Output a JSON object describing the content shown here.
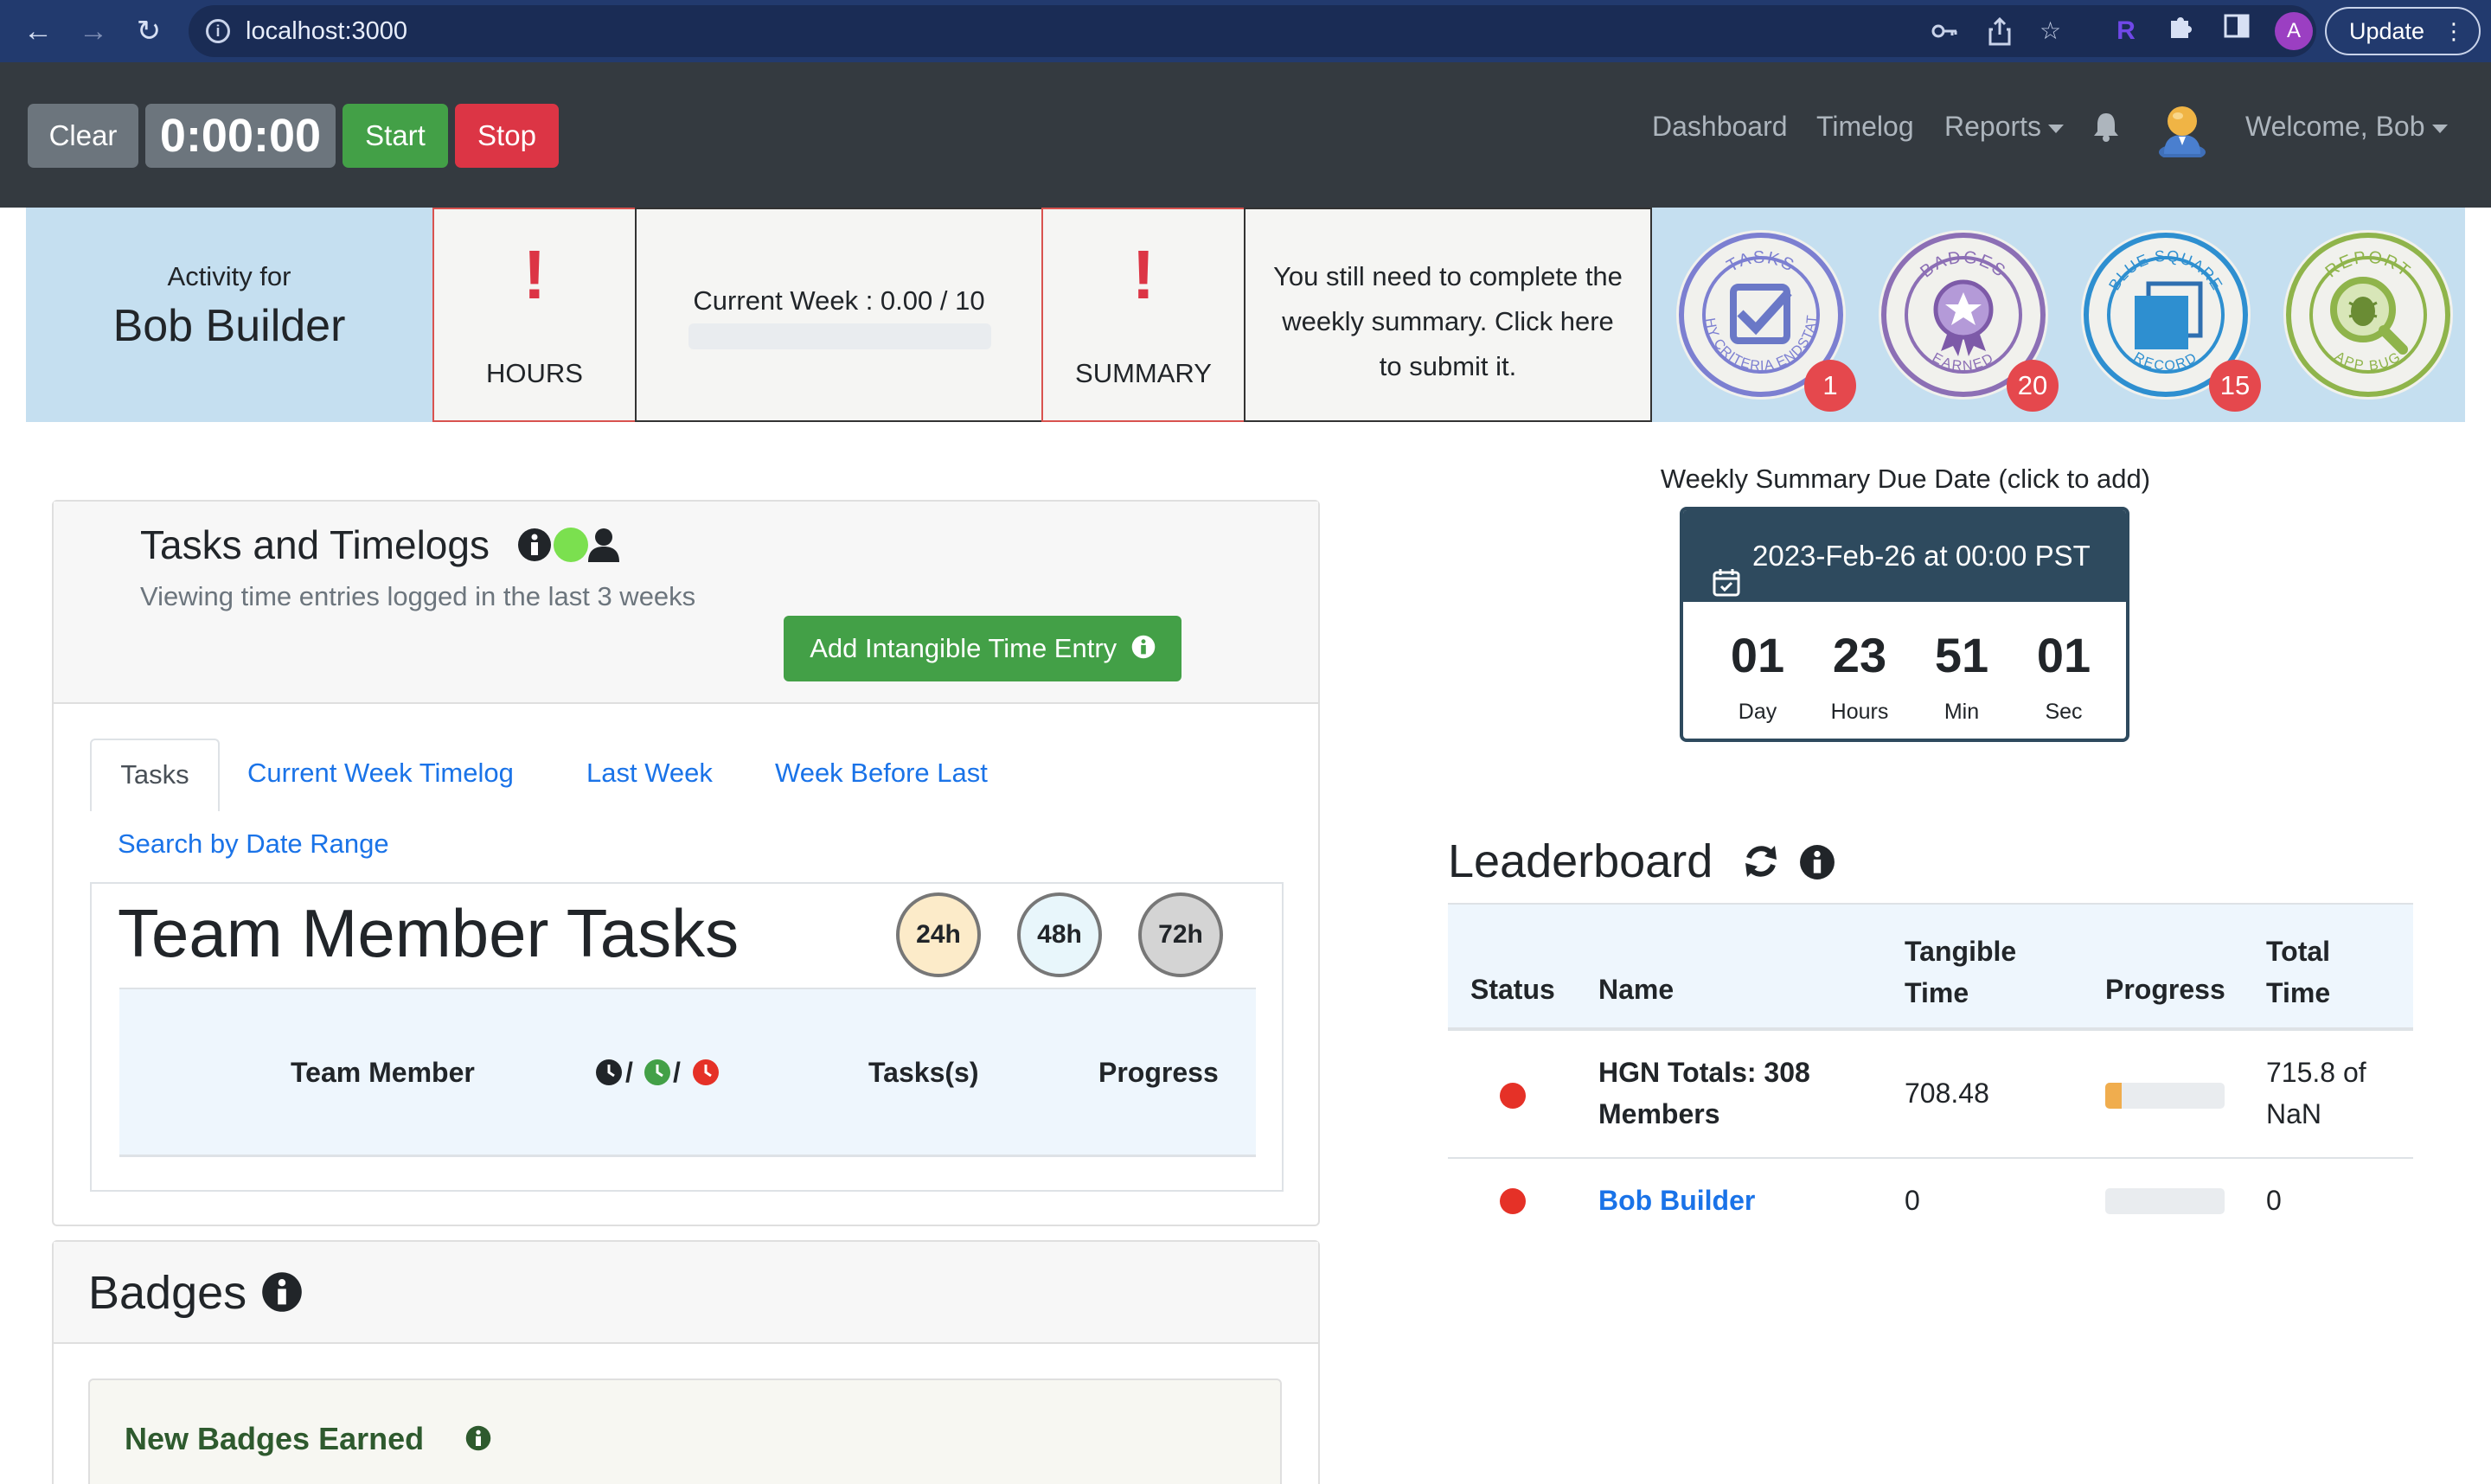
{
  "browser": {
    "url": "localhost:3000",
    "profile_initial": "A",
    "update_label": "Update"
  },
  "timer": {
    "clear_label": "Clear",
    "display": "0:00:00",
    "start_label": "Start",
    "stop_label": "Stop"
  },
  "nav": {
    "dashboard": "Dashboard",
    "timelog": "Timelog",
    "reports": "Reports",
    "welcome": "Welcome, Bob"
  },
  "activity": {
    "label": "Activity for",
    "name": "Bob Builder",
    "hours_label": "HOURS",
    "current_week": "Current Week : 0.00 / 10",
    "week_progress": 0,
    "summary_label": "SUMMARY",
    "summary_message": [
      "You still need to complete the",
      "weekly summary. Click here",
      "to submit it."
    ],
    "badges": [
      {
        "top": "TASKS",
        "bottom": "WHY CRITERIA ENDSTATE",
        "count": "1",
        "color": "#7c7fd1"
      },
      {
        "top": "BADGES",
        "bottom": "EARNED",
        "count": "20",
        "color": "#8c6fb5"
      },
      {
        "top": "BLUE SQUARE",
        "bottom": "RECORD",
        "count": "15",
        "color": "#2e8fd0"
      },
      {
        "top": "REPORT",
        "bottom": "APP BUG",
        "count": "",
        "color": "#8fb44b"
      }
    ]
  },
  "tasks_card": {
    "title": "Tasks and Timelogs",
    "subtitle": "Viewing time entries logged in the last 3 weeks",
    "add_button": "Add Intangible Time Entry",
    "tabs": [
      "Tasks",
      "Current Week Timelog",
      "Last Week",
      "Week Before Last",
      "Search by Date Range"
    ],
    "section_title": "Team Member Tasks",
    "time_filters": [
      "24h",
      "48h",
      "72h"
    ],
    "columns": [
      "Team Member",
      "Tasks(s)",
      "Progress"
    ],
    "column_sep": "/"
  },
  "badges_card": {
    "title": "Badges",
    "new_badges": "New Badges Earned"
  },
  "due_date": {
    "label": "Weekly Summary Due Date (click to add)",
    "date": "2023-Feb-26 at 00:00 PST",
    "countdown": [
      {
        "value": "01",
        "unit": "Day"
      },
      {
        "value": "23",
        "unit": "Hours"
      },
      {
        "value": "51",
        "unit": "Min"
      },
      {
        "value": "01",
        "unit": "Sec"
      }
    ]
  },
  "leaderboard": {
    "title": "Leaderboard",
    "columns": {
      "status": "Status",
      "name": "Name",
      "tangible": [
        "Tangible",
        "Time"
      ],
      "progress": "Progress",
      "total": [
        "Total",
        "Time"
      ]
    },
    "rows": [
      {
        "name_lines": [
          "HGN Totals: 308",
          "Members"
        ],
        "tangible": "708.48",
        "progress": 0.14,
        "total_lines": [
          "715.8 of",
          "NaN"
        ],
        "status_color": "#e53127"
      },
      {
        "name_lines": [
          "Bob Builder"
        ],
        "tangible": "0",
        "progress": 0,
        "total_lines": [
          "0"
        ],
        "status_color": "#e53127"
      }
    ]
  },
  "colors": {
    "navbar": "#343a40",
    "accent_link": "#1a73e8",
    "success": "#43a047",
    "danger": "#dc3545"
  }
}
